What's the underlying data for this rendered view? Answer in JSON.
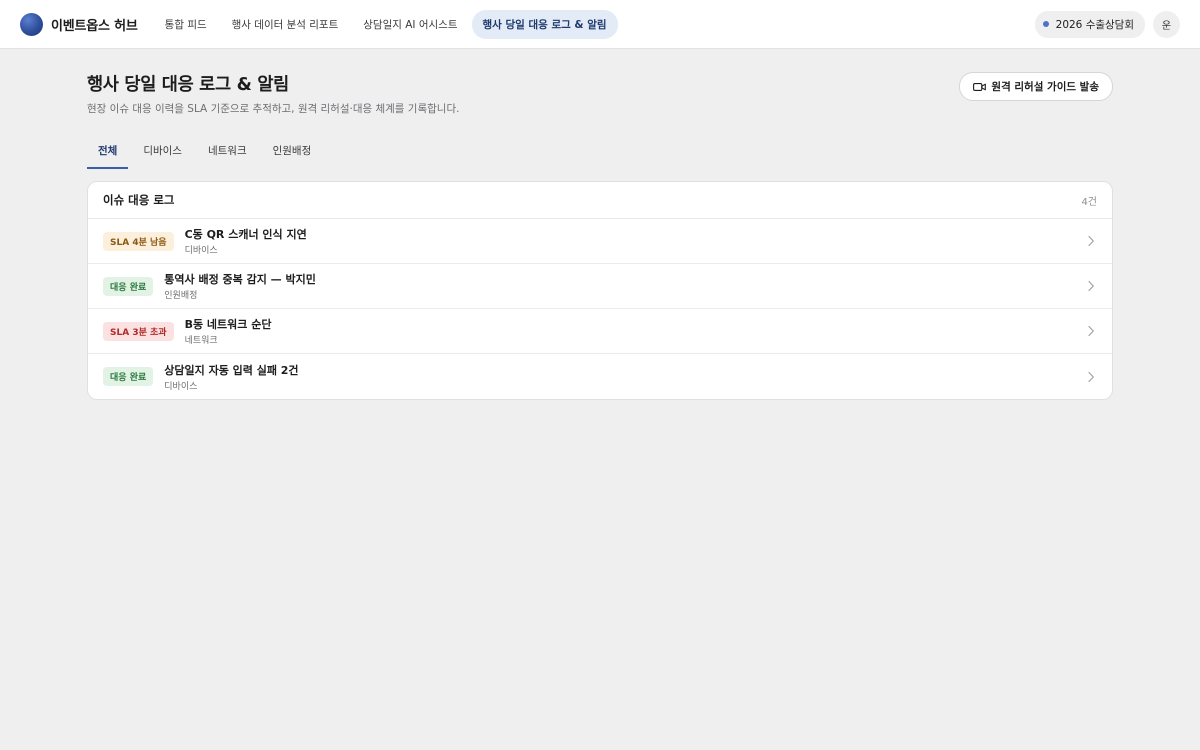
{
  "brand": {
    "name": "이벤트옵스 허브"
  },
  "nav": [
    {
      "label": "통합 피드",
      "active": false
    },
    {
      "label": "행사 데이터 분석 리포트",
      "active": false
    },
    {
      "label": "상담일지 AI 어시스트",
      "active": false
    },
    {
      "label": "행사 당일 대응 로그 & 알림",
      "active": true
    }
  ],
  "event_selector": {
    "label": "2026 수출상담회",
    "dot_color": "#4a73c9"
  },
  "user": {
    "avatar_initial": "운"
  },
  "page": {
    "title": "행사 당일 대응 로그 & 알림",
    "subtitle": "현장 이슈 대응 이력을 SLA 기준으로 추적하고, 원격 리허설·대응 체계를 기록합니다.",
    "action_button": "원격 리허설 가이드 발송",
    "action_icon": "video-camera-icon"
  },
  "tabs": [
    {
      "label": "전체",
      "active": true
    },
    {
      "label": "디바이스",
      "active": false
    },
    {
      "label": "네트워크",
      "active": false
    },
    {
      "label": "인원배정",
      "active": false
    }
  ],
  "log": {
    "title": "이슈 대응 로그",
    "count": "4건",
    "items": [
      {
        "badge": "SLA 4분 남음",
        "status": "warn",
        "title": "C동 QR 스캐너 인식 지연",
        "category": "디바이스"
      },
      {
        "badge": "대응 완료",
        "status": "done",
        "title": "통역사 배정 중복 감지 — 박지민",
        "category": "인원배정"
      },
      {
        "badge": "SLA 3분 초과",
        "status": "over",
        "title": "B동 네트워크 순단",
        "category": "네트워크"
      },
      {
        "badge": "대응 완료",
        "status": "done",
        "title": "상담일지 자동 입력 실패 2건",
        "category": "디바이스"
      }
    ]
  },
  "colors": {
    "accent": "#3b5fa8",
    "warn_bg": "#fcefdc",
    "warn_fg": "#8a5a14",
    "done_bg": "#e2f3e6",
    "done_fg": "#2a7a3d",
    "over_bg": "#fbe1e1",
    "over_fg": "#b02a2a"
  }
}
